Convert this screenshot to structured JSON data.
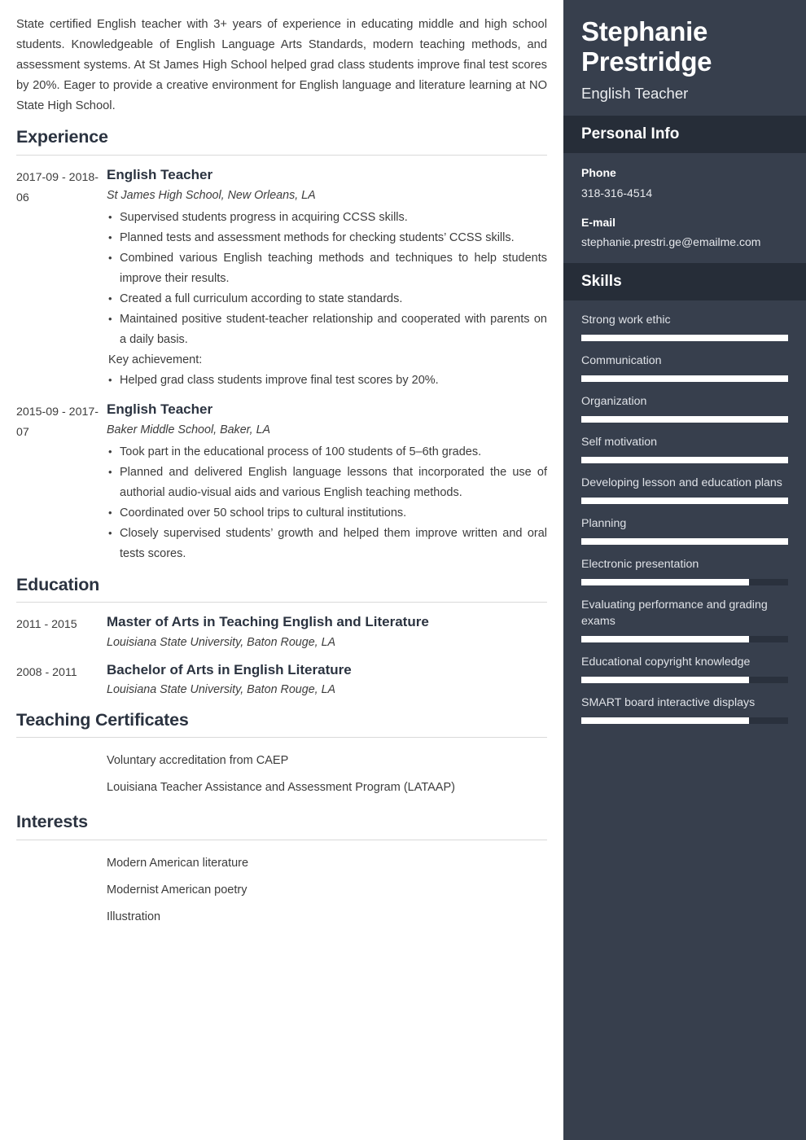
{
  "colors": {
    "sidebar_bg": "#373f4d",
    "sidebar_band_bg": "#262d38",
    "heading": "#2b3340",
    "body_text": "#3c3c3c",
    "rule": "#d9d9d9",
    "skill_fill": "#ffffff",
    "skill_track": "#2a313d"
  },
  "summary": "State certified English teacher with 3+ years of experience in educating middle and high school students. Knowledgeable of English Language Arts Standards, modern teaching methods, and assessment systems. At St James High School helped grad class students improve final test scores by 20%. Eager to provide a creative environment for English language and literature learning at NO State High School.",
  "sections": {
    "experience": {
      "title": "Experience",
      "entries": [
        {
          "dates": "2017-09 - 2018-06",
          "role": "English Teacher",
          "org": "St James High School, New Orleans, LA",
          "bullets": [
            {
              "text": "Supervised students progress in acquiring CCSS skills.",
              "bulleted": true
            },
            {
              "text": "Planned tests and assessment methods for checking students’ CCSS skills.",
              "bulleted": true
            },
            {
              "text": "Combined various English teaching methods and techniques to help students improve their results.",
              "bulleted": true
            },
            {
              "text": "Created a full curriculum according to state standards.",
              "bulleted": true
            },
            {
              "text": "Maintained positive student-teacher relationship and cooperated with parents on a daily basis.",
              "bulleted": true
            },
            {
              "text": "Key achievement:",
              "bulleted": false
            },
            {
              "text": "Helped grad class students improve final test scores by 20%.",
              "bulleted": true
            }
          ]
        },
        {
          "dates": "2015-09 - 2017-07",
          "role": "English Teacher",
          "org": "Baker Middle School, Baker, LA",
          "bullets": [
            {
              "text": "Took part in the educational process of 100 students of 5–6th grades.",
              "bulleted": true
            },
            {
              "text": "Planned and delivered English language lessons that incorporated the use of authorial audio-visual aids and various English teaching methods.",
              "bulleted": true
            },
            {
              "text": "Coordinated over 50 school trips to cultural institutions.",
              "bulleted": true
            },
            {
              "text": "Closely supervised students’ growth and helped them improve written and oral tests scores.",
              "bulleted": true
            }
          ]
        }
      ]
    },
    "education": {
      "title": "Education",
      "entries": [
        {
          "dates": "2011 - 2015",
          "degree": "Master of Arts in Teaching English and Literature",
          "school": "Louisiana State University, Baton Rouge, LA"
        },
        {
          "dates": "2008 - 2011",
          "degree": "Bachelor of Arts in English Literature",
          "school": "Louisiana State University, Baton Rouge, LA"
        }
      ]
    },
    "certificates": {
      "title": "Teaching Certificates",
      "items": [
        "Voluntary accreditation from CAEP",
        "Louisiana Teacher Assistance and Assessment Program (LATAAP)"
      ]
    },
    "interests": {
      "title": "Interests",
      "items": [
        "Modern American literature",
        "Modernist American poetry",
        "Illustration"
      ]
    }
  },
  "sidebar": {
    "name": "Stephanie Prestridge",
    "job_title": "English Teacher",
    "personal_info": {
      "title": "Personal Info",
      "fields": [
        {
          "label": "Phone",
          "value": "318-316-4514"
        },
        {
          "label": "E-mail",
          "value": "stephanie.prestri.ge@emailme.com"
        }
      ]
    },
    "skills": {
      "title": "Skills",
      "items": [
        {
          "name": "Strong work ethic",
          "level": 100
        },
        {
          "name": "Communication",
          "level": 100
        },
        {
          "name": "Organization",
          "level": 100
        },
        {
          "name": "Self motivation",
          "level": 100
        },
        {
          "name": "Developing lesson and education plans",
          "level": 100
        },
        {
          "name": "Planning",
          "level": 100
        },
        {
          "name": "Electronic presentation",
          "level": 81
        },
        {
          "name": "Evaluating performance and grading exams",
          "level": 81
        },
        {
          "name": "Educational copyright knowledge",
          "level": 81
        },
        {
          "name": "SMART board interactive displays",
          "level": 81
        }
      ]
    }
  }
}
